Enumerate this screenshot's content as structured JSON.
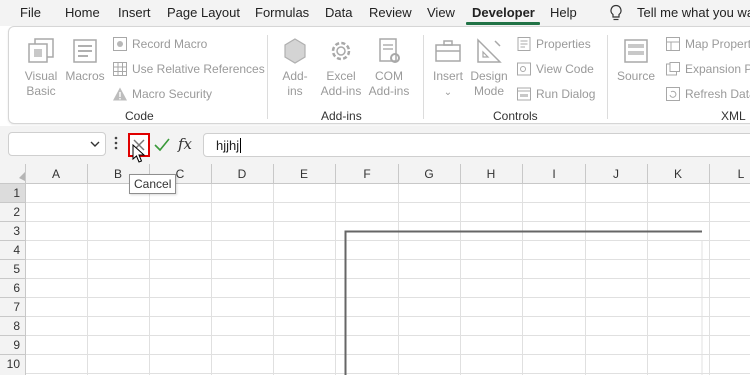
{
  "menu": {
    "items": [
      "File",
      "Home",
      "Insert",
      "Page Layout",
      "Formulas",
      "Data",
      "Review",
      "View",
      "Developer",
      "Help"
    ],
    "active": "Developer",
    "tell_me": "Tell me what you wa"
  },
  "ribbon": {
    "code": {
      "label": "Code",
      "visual_basic": [
        "Visual",
        "Basic"
      ],
      "macros": "Macros",
      "record_macro": "Record Macro",
      "relative_refs": "Use Relative References",
      "macro_security": "Macro Security"
    },
    "addins": {
      "label": "Add-ins",
      "addins": [
        "Add-",
        "ins"
      ],
      "excel_addins": [
        "Excel",
        "Add-ins"
      ],
      "com_addins": [
        "COM",
        "Add-ins"
      ]
    },
    "controls": {
      "label": "Controls",
      "insert": "Insert",
      "design_mode": [
        "Design",
        "Mode"
      ],
      "properties": "Properties",
      "view_code": "View Code",
      "run_dialog": "Run Dialog"
    },
    "xml": {
      "label": "XML",
      "source": "Source",
      "map_properties": "Map Propertie",
      "expansion_packs": "Expansion Pa",
      "refresh_data": "Refresh Data"
    }
  },
  "formula_bar": {
    "name_box": "",
    "fx": "fx",
    "value": "hjjhj",
    "tooltip": "Cancel"
  },
  "grid": {
    "columns": [
      "A",
      "B",
      "C",
      "D",
      "E",
      "F",
      "G",
      "H",
      "I",
      "J",
      "K",
      "L"
    ],
    "rows": [
      "1",
      "2",
      "3",
      "4",
      "5",
      "6",
      "7",
      "8",
      "9",
      "10"
    ],
    "selected_row": "1"
  },
  "colors": {
    "accent": "#217346",
    "cancel_highlight": "#e00000",
    "enter_check": "#3a9a3a"
  },
  "icons": {
    "tell_me": "lightbulb-icon",
    "cancel": "cancel-x-icon",
    "enter": "checkmark-icon",
    "cursor": "mouse-pointer-icon"
  }
}
